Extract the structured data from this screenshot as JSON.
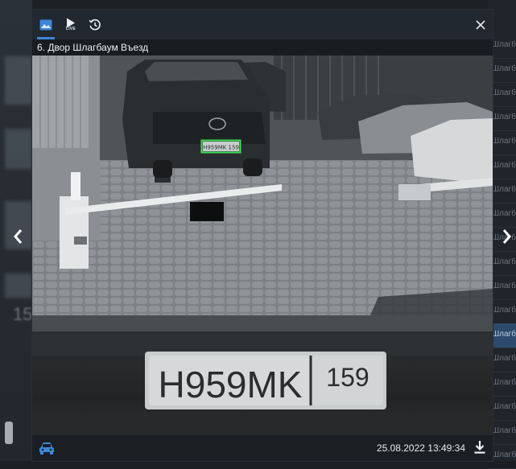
{
  "modal": {
    "camera_title": "6. Двор Шлагбаум Въезд",
    "tabs": [
      {
        "name": "image-icon",
        "active": true
      },
      {
        "name": "live-icon",
        "label": "LIVE"
      },
      {
        "name": "history-icon"
      }
    ],
    "close_icon": "close-icon",
    "recognized_plate": "H959MK 159",
    "plate_crop": {
      "main": "H959MK",
      "region": "159"
    },
    "timestamp": "25.08.2022 13:49:34",
    "vehicle_icon": "car-icon",
    "download_icon": "download-icon"
  },
  "navigation": {
    "prev_icon": "chevron-left-icon",
    "next_icon": "chevron-right-icon"
  },
  "background": {
    "left_fragment": "15",
    "list_items": [
      "Шлагбаум",
      "Шлагбаум",
      "Шлагбаум",
      "Шлагбаум",
      "Шлагбаум",
      "Шлагбаум",
      "Шлагбаум",
      "Шлагбаум",
      "Шлагбаум",
      "Шлагбаум",
      "Шлагбаум",
      "Шлагбаум",
      "Шлагбаум",
      "Шлагбаум",
      "Шлагбаум",
      "Шлагбаум",
      "Шлагбаум",
      "Шлагбаум"
    ]
  },
  "colors": {
    "accent": "#3d86d8",
    "plate_box": "#3fe05a",
    "modal_bg": "#191d22"
  }
}
